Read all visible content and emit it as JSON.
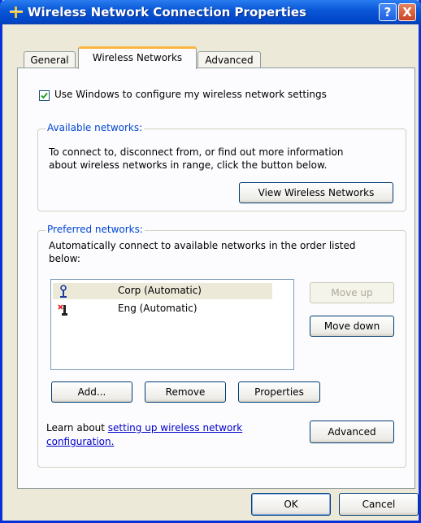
{
  "window": {
    "title": "Wireless Network Connection Properties",
    "help_label": "?",
    "close_label": "X"
  },
  "tabs": [
    {
      "label": "General",
      "active": false
    },
    {
      "label": "Wireless Networks",
      "active": true
    },
    {
      "label": "Advanced",
      "active": false
    }
  ],
  "use_windows": {
    "label": "Use Windows to configure my wireless network settings",
    "checked": true
  },
  "available": {
    "legend": "Available networks:",
    "description_line1": "To connect to, disconnect from, or find out more information",
    "description_line2": "about wireless networks in range, click the button below.",
    "view_button": "View Wireless Networks"
  },
  "preferred": {
    "legend": "Preferred networks:",
    "description_line1": "Automatically connect to available networks in the order listed",
    "description_line2": "below:",
    "networks": [
      {
        "label": "Corp (Automatic)",
        "icon": "antenna-connected-icon",
        "selected": true
      },
      {
        "label": "Eng (Automatic)",
        "icon": "antenna-disconnected-icon",
        "selected": false
      }
    ],
    "move_up": "Move up",
    "move_down": "Move down",
    "add": "Add...",
    "remove": "Remove",
    "properties": "Properties",
    "learn_prefix": "Learn about ",
    "learn_link_line1": "setting up wireless network",
    "learn_link_line2": "configuration.",
    "advanced": "Advanced"
  },
  "footer": {
    "ok": "OK",
    "cancel": "Cancel"
  },
  "colors": {
    "titlebar": "#0a58d8",
    "legend": "#0046d5",
    "link": "#0000cc"
  }
}
